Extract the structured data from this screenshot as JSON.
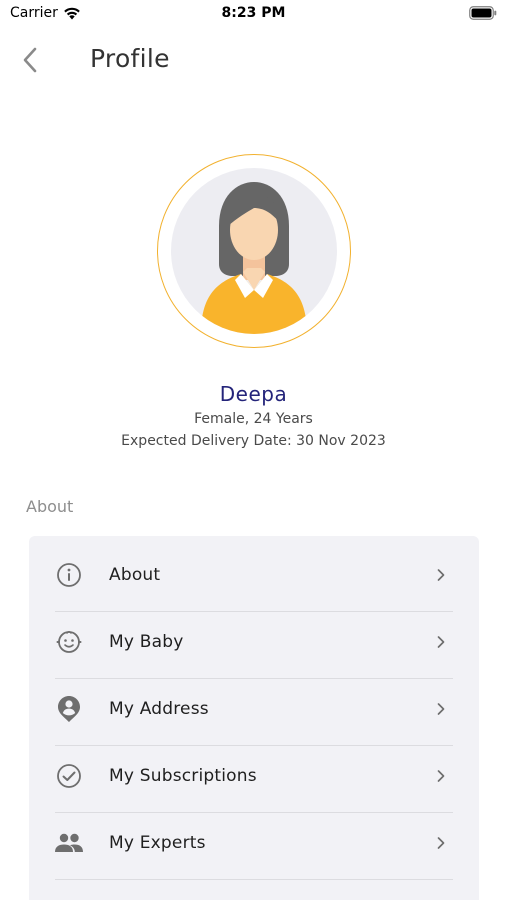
{
  "status_bar": {
    "carrier": "Carrier",
    "time": "8:23 PM"
  },
  "nav": {
    "title": "Profile",
    "back_icon": "chevron-left-icon"
  },
  "profile": {
    "name": "Deepa",
    "gender_age": "Female,  24 Years",
    "expected_delivery": "Expected Delivery Date: 30 Nov 2023"
  },
  "section": {
    "label": "About"
  },
  "menu": {
    "items": [
      {
        "label": "About",
        "icon": "info-icon"
      },
      {
        "label": "My Baby",
        "icon": "baby-face-icon"
      },
      {
        "label": "My Address",
        "icon": "location-pin-icon"
      },
      {
        "label": "My Subscriptions",
        "icon": "check-circle-icon"
      },
      {
        "label": "My Experts",
        "icon": "people-icon"
      }
    ]
  },
  "colors": {
    "accent_ring": "#f2b12e",
    "name_color": "#24247a",
    "card_bg": "#f2f2f6",
    "shirt": "#f9b42c",
    "hair": "#666666",
    "skin": "#f9d6b1"
  }
}
